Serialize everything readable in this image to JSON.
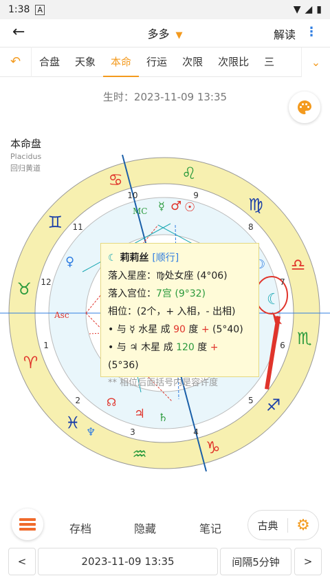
{
  "status": {
    "time": "1:38",
    "sim_icon": "A",
    "signal_icons": "wifi-signal-battery"
  },
  "appbar": {
    "title": "多多",
    "read": "解读"
  },
  "tabs": [
    {
      "label": "合盘"
    },
    {
      "label": "天象"
    },
    {
      "label": "本命",
      "active": true
    },
    {
      "label": "行运"
    },
    {
      "label": "次限"
    },
    {
      "label": "次限比"
    },
    {
      "label": "三"
    }
  ],
  "birth_time": "生时：2023-11-09 13:35",
  "chart_label": {
    "title": "本命盘",
    "system": "Placidus",
    "zodiac": "回归黄道"
  },
  "wheel": {
    "house_numbers": [
      "1",
      "2",
      "3",
      "4",
      "5",
      "6",
      "7",
      "8",
      "9",
      "10",
      "11",
      "12"
    ],
    "angles": {
      "asc": "Asc",
      "mc": "MC"
    },
    "sign_glyphs": [
      "♈",
      "♉",
      "♊",
      "♋",
      "♌",
      "♍",
      "♎",
      "♏",
      "♐",
      "♑",
      "♒",
      "♓"
    ],
    "sign_color": "#1a3ea8",
    "outer_ring_color": "#f7f0b0"
  },
  "popup": {
    "planet_glyph": "☾",
    "planet_name": "莉莉丝",
    "motion": "[顺行]",
    "sign_line_label": "落入星座：",
    "sign_line_value": "♍处女座 (4°06)",
    "house_line_label": "落入宫位：",
    "house_line_value": "7宫 (9°32)",
    "aspects_header": "相位：(2个，+ 入相，- 出相)",
    "aspect1_prefix": "• 与 ☿ 水星 成 ",
    "aspect1_degree": "90",
    "aspect1_suffix": " 度 ",
    "aspect1_sign": "+",
    "aspect1_orb": " (5°40)",
    "aspect2_prefix": "• 与 ♃ 木星 成 ",
    "aspect2_degree": "120",
    "aspect2_suffix": " 度 ",
    "aspect2_sign": "+",
    "aspect2_orb": " (5°36)",
    "note": "** 相位后面括号内是容许度"
  },
  "bottom": {
    "save": "存档",
    "hide": "隐藏",
    "note": "笔记",
    "classic": "古典"
  },
  "nav": {
    "prev": "<",
    "datetime": "2023-11-09 13:35",
    "interval": "间隔5分钟",
    "next": ">"
  }
}
